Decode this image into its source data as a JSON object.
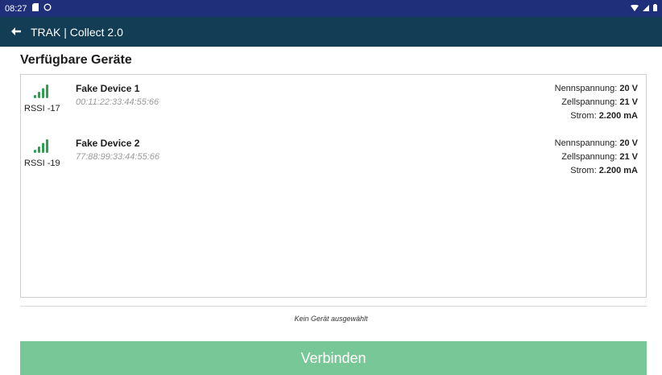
{
  "status_bar": {
    "time": "08:27",
    "icons": [
      "sd-card-icon",
      "sync-icon"
    ],
    "right_icons": [
      "wifi-icon",
      "cellular-icon",
      "battery-icon"
    ]
  },
  "app_bar": {
    "title": "TRAK | Collect 2.0",
    "background": "#123d54"
  },
  "section_title": "Verfügbare Geräte",
  "devices": [
    {
      "name": "Fake Device 1",
      "mac": "00:11:22:33:44:55:66",
      "rssi": "RSSI -17",
      "nennspannung_label": "Nennspannung: ",
      "nennspannung": "20 V",
      "zellspannung_label": "Zellspannung: ",
      "zellspannung": "21 V",
      "strom_label": "Strom: ",
      "strom": "2.200 mA"
    },
    {
      "name": "Fake Device 2",
      "mac": "77:88:99:33:44:55:66",
      "rssi": "RSSI -19",
      "nennspannung_label": "Nennspannung: ",
      "nennspannung": "20 V",
      "zellspannung_label": "Zellspannung: ",
      "zellspannung": "21 V",
      "strom_label": "Strom: ",
      "strom": "2.200 mA"
    }
  ],
  "selection_status": "Kein Gerät ausgewählt",
  "connect_button": {
    "label": "Verbinden",
    "color": "#77c896"
  },
  "signal_color": "#2e9e4f"
}
